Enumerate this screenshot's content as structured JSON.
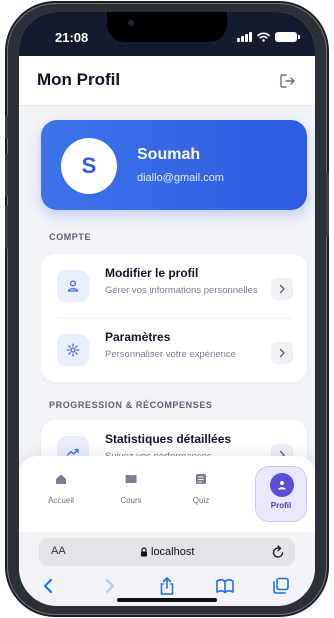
{
  "status_bar": {
    "time": "21:08"
  },
  "header": {
    "title": "Mon Profil",
    "logout_icon": "logout-icon"
  },
  "profile": {
    "avatar_letter": "S",
    "name": "Soumah",
    "email": "diallo@gmail.com"
  },
  "sections": {
    "account": {
      "label": "COMPTE",
      "items": [
        {
          "title": "Modifier le profil",
          "subtitle": "Gérer vos informations personnelles",
          "icon": "user-icon"
        },
        {
          "title": "Paramètres",
          "subtitle": "Personnaliser votre expérience",
          "icon": "gear-icon"
        }
      ]
    },
    "progress": {
      "label": "PROGRESSION & RÉCOMPENSES",
      "items": [
        {
          "title": "Statistiques détaillées",
          "subtitle": "Suivez vos performances",
          "icon": "trend-icon"
        }
      ]
    }
  },
  "tabs": [
    {
      "label": "Accueil",
      "icon": "home-icon"
    },
    {
      "label": "Cours",
      "icon": "book-icon"
    },
    {
      "label": "Quiz",
      "icon": "quiz-icon"
    },
    {
      "label": "Profil",
      "icon": "profile-icon",
      "active": true
    }
  ],
  "browser": {
    "aa": "AA",
    "url": "localhost"
  },
  "colors": {
    "accent": "#2d5ce0",
    "active_tab": "#5a4fd4",
    "page_bg": "#f3f4f8"
  }
}
